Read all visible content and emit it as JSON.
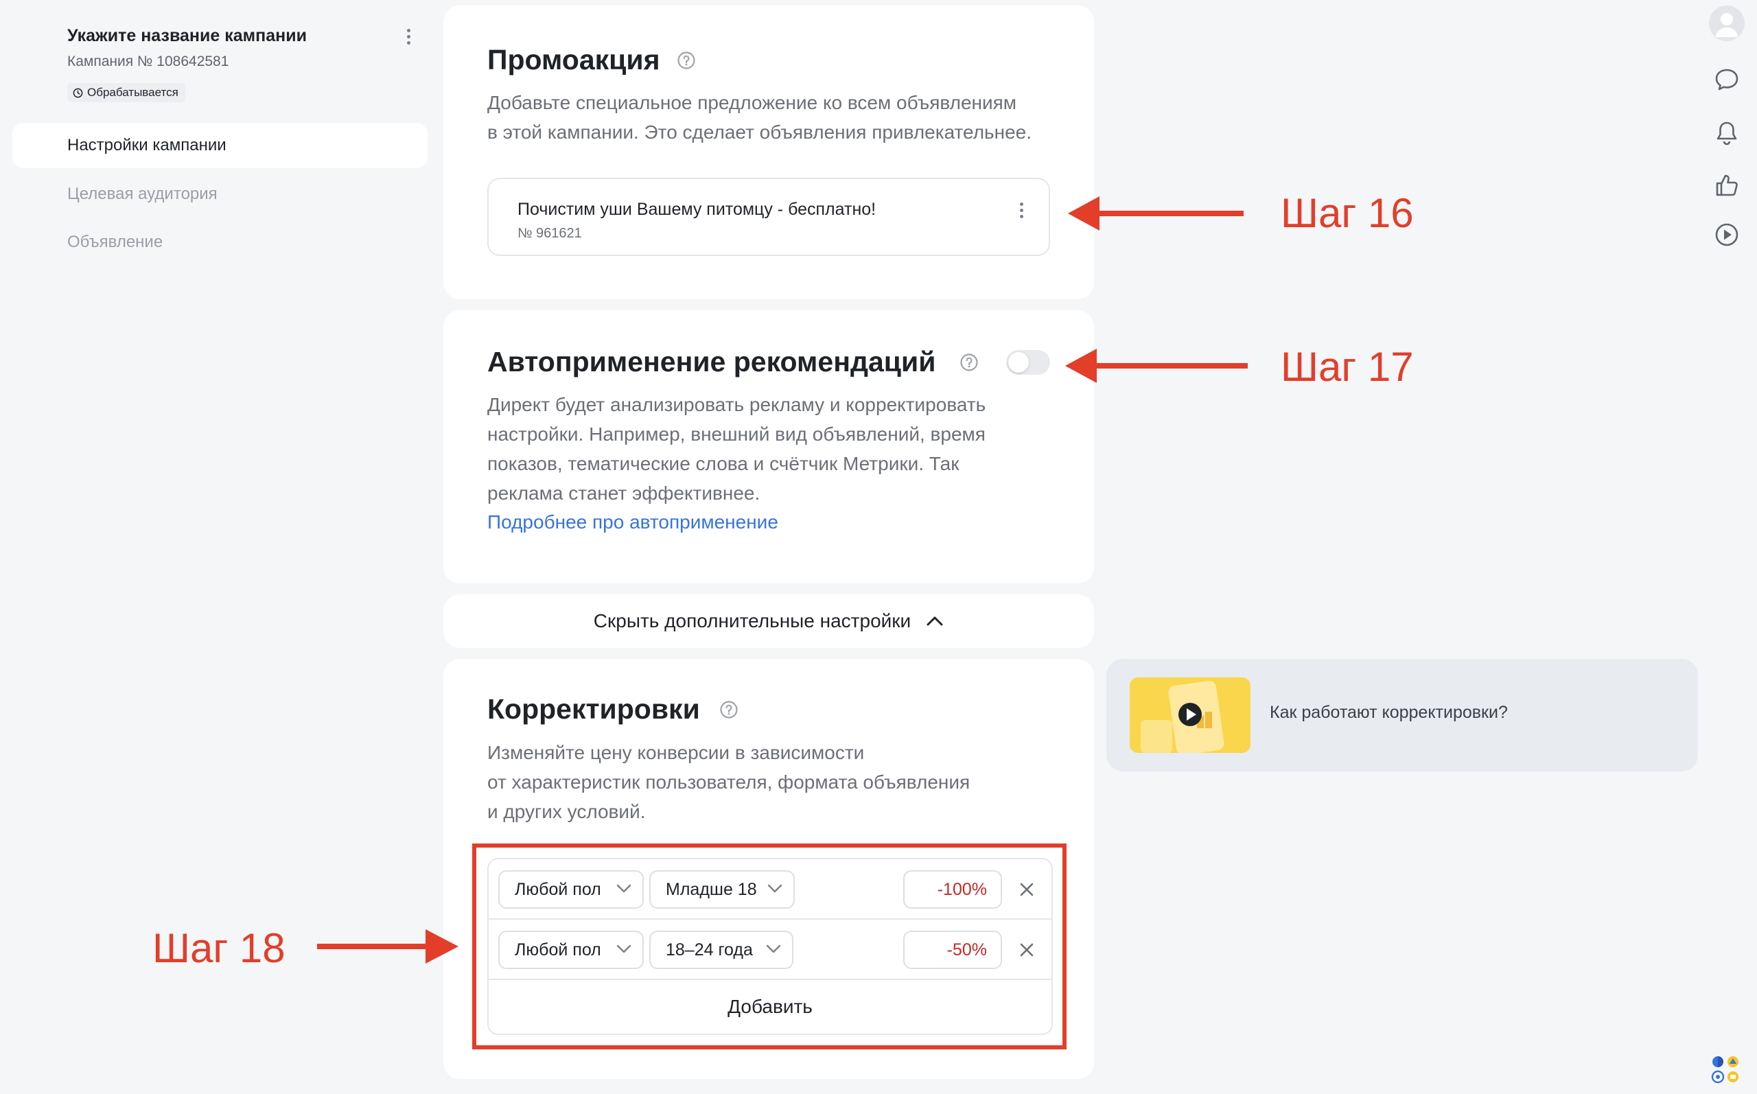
{
  "sidebar": {
    "campaign_title": "Укажите название кампании",
    "campaign_number": "Кампания № 108642581",
    "status": "Обрабатывается",
    "items": [
      {
        "label": "Настройки кампании",
        "active": true
      },
      {
        "label": "Целевая аудитория",
        "active": false
      },
      {
        "label": "Объявление",
        "active": false
      }
    ]
  },
  "promo": {
    "title": "Промоакция",
    "description_line1": "Добавьте специальное предложение ко всем объявлениям",
    "description_line2": "в этой кампании. Это сделает объявления привлекательнее.",
    "item_name": "Почистим уши Вашему питомцу - бесплатно!",
    "item_number": "№ 961621"
  },
  "autoapply": {
    "title": "Автоприменение рекомендаций",
    "enabled": false,
    "description_line1": "Директ будет анализировать рекламу и корректировать",
    "description_line2": "настройки. Например, внешний вид объявлений, время",
    "description_line3": "показов, тематические слова и счётчик Метрики. Так",
    "description_line4": "реклама станет эффективнее.",
    "link": "Подробнее про автоприменение"
  },
  "hide_settings_label": "Скрыть дополнительные настройки",
  "adjustments": {
    "title": "Корректировки",
    "description_line1": "Изменяйте цену конверсии в зависимости",
    "description_line2": "от характеристик пользователя, формата объявления",
    "description_line3": "и других условий.",
    "rows": [
      {
        "gender": "Любой пол",
        "age": "Младше 18",
        "value": "-100%"
      },
      {
        "gender": "Любой пол",
        "age": "18–24 года",
        "value": "-50%"
      }
    ],
    "add_label": "Добавить"
  },
  "video_tip": {
    "label": "Как работают корректировки?"
  },
  "annotations": {
    "step16": "Шаг 16",
    "step17": "Шаг 17",
    "step18": "Шаг 18"
  },
  "rail_icons": [
    "avatar",
    "chat-icon",
    "bell-icon",
    "thumb-up-icon",
    "play-icon"
  ],
  "colors": {
    "accent_link": "#3872e0",
    "annotation_red": "#e23e2a",
    "negative_value": "#c62828",
    "background": "#f5f6f8"
  }
}
